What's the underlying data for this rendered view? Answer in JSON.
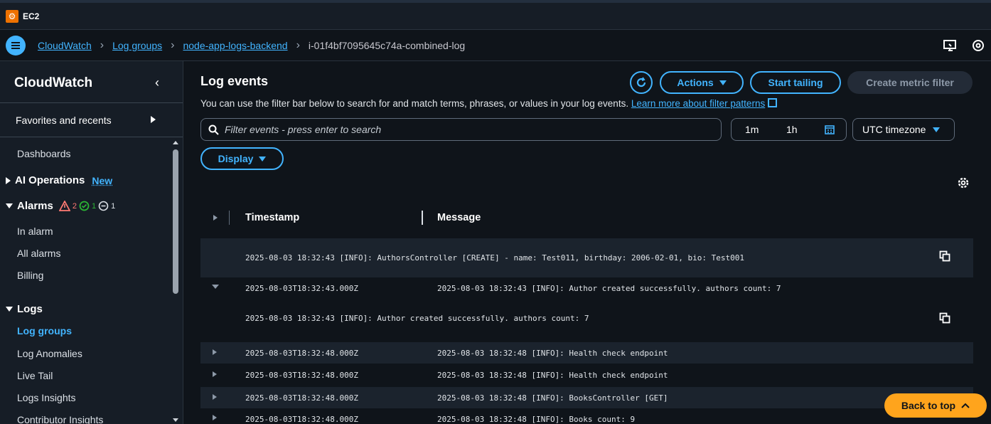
{
  "topbar": {
    "service": "EC2"
  },
  "breadcrumb": {
    "items": [
      "CloudWatch",
      "Log groups",
      "node-app-logs-backend"
    ],
    "current": "i-01f4bf7095645c74a-combined-log"
  },
  "sidebar": {
    "title": "CloudWatch",
    "favorites": "Favorites and recents",
    "dashboards": "Dashboards",
    "ai_operations": "AI Operations",
    "ai_new": "New",
    "alarms": {
      "label": "Alarms",
      "alarm_count": "2",
      "ok_count": "1",
      "insufficient_count": "1"
    },
    "alarm_items": [
      "In alarm",
      "All alarms",
      "Billing"
    ],
    "logs": "Logs",
    "log_items": [
      "Log groups",
      "Log Anomalies",
      "Live Tail",
      "Logs Insights",
      "Contributor Insights"
    ]
  },
  "main": {
    "title": "Log events",
    "description": "You can use the filter bar below to search for and match terms, phrases, or values in your log events.",
    "learn_more": "Learn more about filter patterns",
    "actions_label": "Actions",
    "start_tailing_label": "Start tailing",
    "create_metric_filter_label": "Create metric filter",
    "search_placeholder": "Filter events - press enter to search",
    "range_1m": "1m",
    "range_1h": "1h",
    "timezone": "UTC timezone",
    "display_label": "Display",
    "back_to_top": "Back to top"
  },
  "table": {
    "headers": {
      "timestamp": "Timestamp",
      "message": "Message"
    },
    "expanded_1": "2025-08-03 18:32:43 [INFO]: AuthorsController [CREATE] - name: Test011, birthday: 2006-02-01, bio: Test001",
    "rows": [
      {
        "timestamp": "2025-08-03T18:32:43.000Z",
        "message": "2025-08-03 18:32:43 [INFO]: Author created successfully. authors count: 7"
      },
      {
        "timestamp": "2025-08-03T18:32:48.000Z",
        "message": "2025-08-03 18:32:48 [INFO]: Health check endpoint"
      },
      {
        "timestamp": "2025-08-03T18:32:48.000Z",
        "message": "2025-08-03 18:32:48 [INFO]: Health check endpoint"
      },
      {
        "timestamp": "2025-08-03T18:32:48.000Z",
        "message": "2025-08-03 18:32:48 [INFO]: BooksController [GET]"
      },
      {
        "timestamp": "2025-08-03T18:32:48.000Z",
        "message": "2025-08-03 18:32:48 [INFO]: Books count: 9"
      }
    ],
    "expanded_2": "2025-08-03 18:32:43 [INFO]: Author created successfully. authors count: 7"
  },
  "icons": {
    "menu": "menu-icon",
    "refresh": "refresh-icon",
    "calendar": "calendar-icon",
    "search": "search-icon",
    "settings": "gear-icon",
    "copy": "copy-icon",
    "external": "external-link-icon"
  },
  "colors": {
    "accent": "#42b4ff",
    "warning": "#ff7a73",
    "success": "#2bb534",
    "back_to_top": "#ffa41c"
  }
}
